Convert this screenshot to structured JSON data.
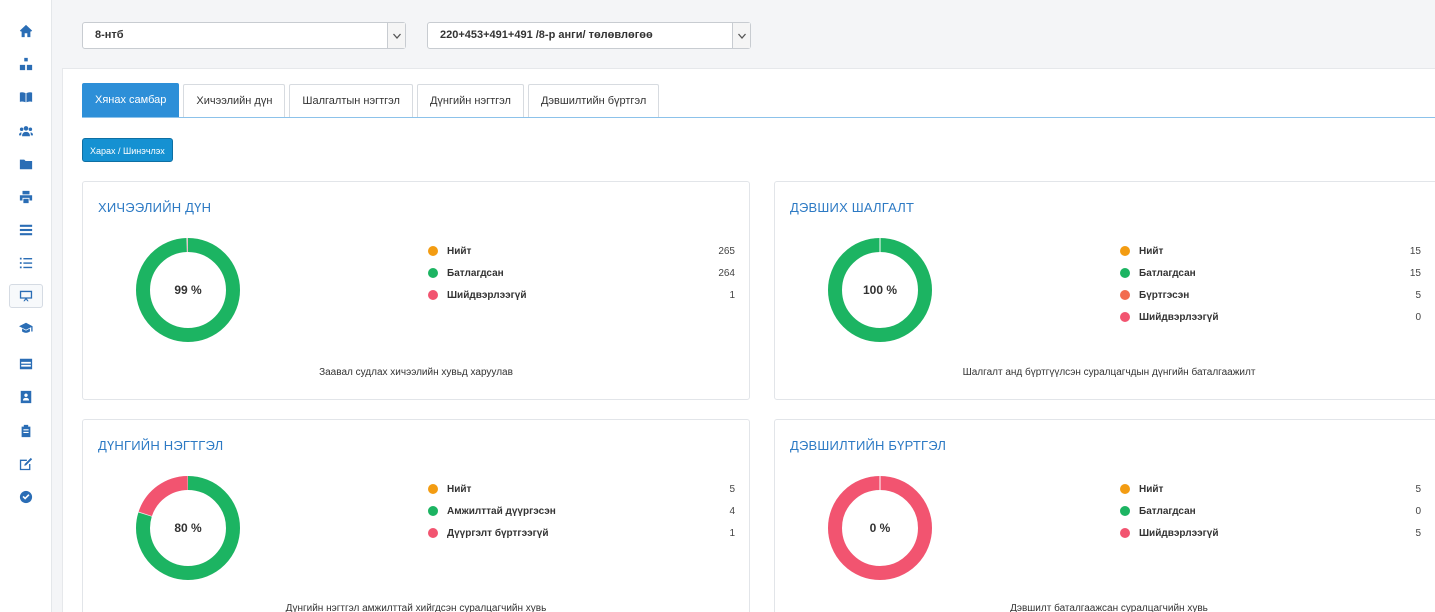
{
  "sidebar": {
    "items": [
      {
        "icon": "home-icon"
      },
      {
        "icon": "sitemap-icon"
      },
      {
        "icon": "book-icon"
      },
      {
        "icon": "users-icon"
      },
      {
        "icon": "folder-icon"
      },
      {
        "icon": "print-icon"
      },
      {
        "icon": "list-icon"
      },
      {
        "icon": "list-ordered-icon"
      },
      {
        "icon": "presentation-icon"
      },
      {
        "icon": "graduation-cap-icon"
      },
      {
        "icon": "table-icon"
      },
      {
        "icon": "id-card-icon"
      },
      {
        "icon": "clipboard-icon"
      },
      {
        "icon": "edit-icon"
      },
      {
        "icon": "check-circle-icon"
      }
    ]
  },
  "filters": {
    "class_select": "8-нтб",
    "plan_select": "220+453+491+491 /8-р анги/ төлөвлөгөө"
  },
  "tabs": [
    {
      "label": "Хянах самбар",
      "active": true
    },
    {
      "label": "Хичээлийн дүн",
      "active": false
    },
    {
      "label": "Шалгалтын нэгтгэл",
      "active": false
    },
    {
      "label": "Дүнгийн нэгтгэл",
      "active": false
    },
    {
      "label": "Дэвшилтийн бүртгэл",
      "active": false
    }
  ],
  "action_button": "Харах / Шинэчлэх",
  "colors": {
    "orange": "#f39c12",
    "green": "#1cb462",
    "coral": "#f26c4f",
    "red": "#f25470",
    "track": "#e8e8e8"
  },
  "cards": [
    {
      "title": "ХИЧЭЭЛИЙН ДҮН",
      "percent_label": "99 %",
      "legend": [
        {
          "color": "#f39c12",
          "label": "Нийт",
          "value": "265"
        },
        {
          "color": "#1cb462",
          "label": "Батлагдсан",
          "value": "264"
        },
        {
          "color": "#f25470",
          "label": "Шийдвэрлээгүй",
          "value": "1"
        }
      ],
      "caption": "Заавал судлах хичээлийн хувьд харуулав",
      "donut": [
        {
          "value": 264,
          "color": "#1cb462"
        },
        {
          "value": 1,
          "color": "#f25470"
        }
      ]
    },
    {
      "title": "ДЭВШИХ ШАЛГАЛТ",
      "percent_label": "100 %",
      "legend": [
        {
          "color": "#f39c12",
          "label": "Нийт",
          "value": "15"
        },
        {
          "color": "#1cb462",
          "label": "Батлагдсан",
          "value": "15"
        },
        {
          "color": "#f26c4f",
          "label": "Бүртгэсэн",
          "value": "5"
        },
        {
          "color": "#f25470",
          "label": "Шийдвэрлээгүй",
          "value": "0"
        }
      ],
      "caption": "Шалгалт анд бүртгүүлсэн суралцагчдын дүнгийн баталгаажилт",
      "donut": [
        {
          "value": 15,
          "color": "#1cb462"
        }
      ]
    },
    {
      "title": "ДҮНГИЙН НЭГТГЭЛ",
      "percent_label": "80 %",
      "legend": [
        {
          "color": "#f39c12",
          "label": "Нийт",
          "value": "5"
        },
        {
          "color": "#1cb462",
          "label": "Амжилттай дүүргэсэн",
          "value": "4"
        },
        {
          "color": "#f25470",
          "label": "Дүүргэлт бүртгээгүй",
          "value": "1"
        }
      ],
      "caption": "Дүнгийн нэгтгэл амжилттай хийгдсэн суралцагчийн хувь",
      "donut": [
        {
          "value": 4,
          "color": "#1cb462"
        },
        {
          "value": 1,
          "color": "#f25470"
        }
      ]
    },
    {
      "title": "ДЭВШИЛТИЙН БҮРТГЭЛ",
      "percent_label": "0 %",
      "legend": [
        {
          "color": "#f39c12",
          "label": "Нийт",
          "value": "5"
        },
        {
          "color": "#1cb462",
          "label": "Батлагдсан",
          "value": "0"
        },
        {
          "color": "#f25470",
          "label": "Шийдвэрлээгүй",
          "value": "5"
        }
      ],
      "caption": "Дэвшилт баталгаажсан суралцагчийн хувь",
      "donut": [
        {
          "value": 5,
          "color": "#f25470"
        }
      ]
    }
  ]
}
